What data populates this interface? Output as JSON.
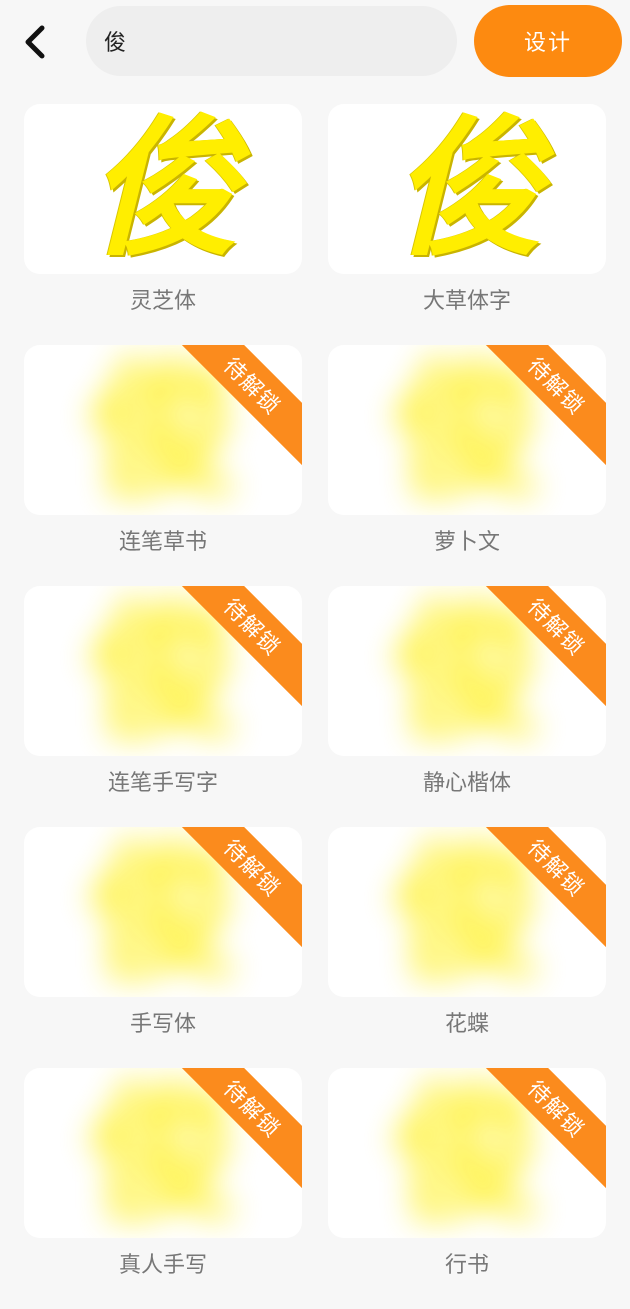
{
  "search": {
    "value": "俊",
    "placeholder": ""
  },
  "design_label": "设计",
  "lock_label": "待解锁",
  "fonts": [
    {
      "name": "灵芝体",
      "locked": false
    },
    {
      "name": "大草体字",
      "locked": false
    },
    {
      "name": "连笔草书",
      "locked": true
    },
    {
      "name": "萝卜文",
      "locked": true
    },
    {
      "name": "连笔手写字",
      "locked": true
    },
    {
      "name": "静心楷体",
      "locked": true
    },
    {
      "name": "手写体",
      "locked": true
    },
    {
      "name": "花蝶",
      "locked": true
    },
    {
      "name": "真人手写",
      "locked": true
    },
    {
      "name": "行书",
      "locked": true
    }
  ],
  "colors": {
    "accent": "#fd8a10",
    "preview": "#ffee00",
    "label": "#777777"
  }
}
